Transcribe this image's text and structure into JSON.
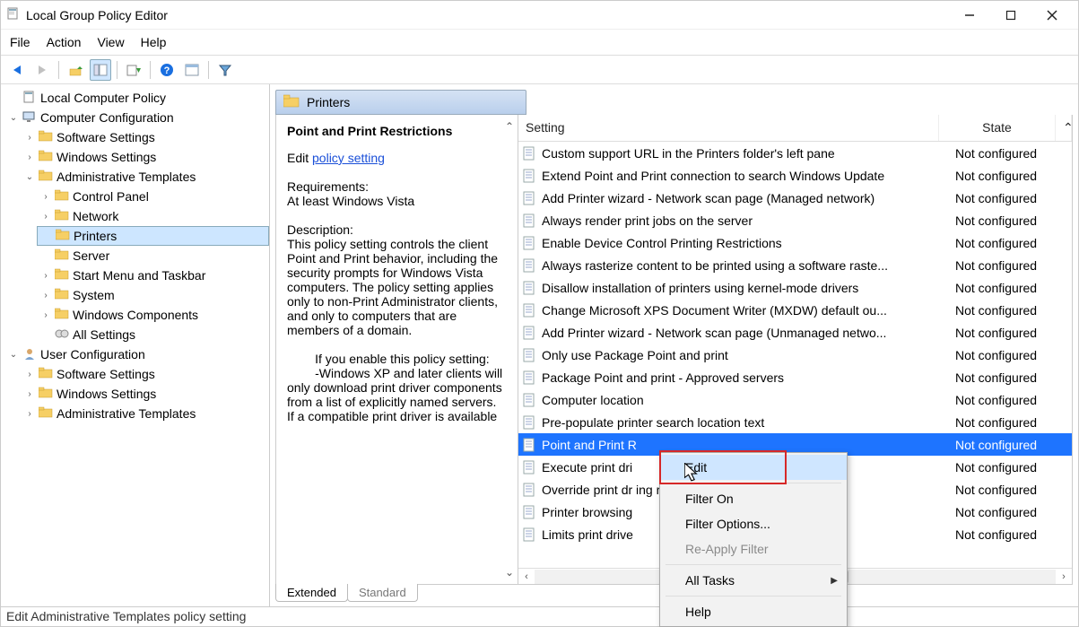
{
  "window": {
    "title": "Local Group Policy Editor",
    "controls": {
      "min": "—",
      "max": "▢",
      "close": "✕"
    }
  },
  "menubar": [
    "File",
    "Action",
    "View",
    "Help"
  ],
  "toolbar_icons": [
    "back-icon",
    "forward-icon",
    "up-icon",
    "show-hide-tree-icon",
    "export-icon",
    "help-icon",
    "properties-icon",
    "filter-icon"
  ],
  "tree": {
    "root": "Local Computer Policy",
    "computer_config": "Computer Configuration",
    "cc_children": {
      "software": "Software Settings",
      "windows": "Windows Settings",
      "admin_templates": "Administrative Templates",
      "at_children": {
        "control_panel": "Control Panel",
        "network": "Network",
        "printers": "Printers",
        "server": "Server",
        "start_menu": "Start Menu and Taskbar",
        "system": "System",
        "win_components": "Windows Components",
        "all_settings": "All Settings"
      }
    },
    "user_config": "User Configuration",
    "uc_children": {
      "software": "Software Settings",
      "windows": "Windows Settings",
      "admin_templates": "Administrative Templates"
    }
  },
  "right_header": "Printers",
  "detail": {
    "heading": "Point and Print Restrictions",
    "edit_label": "Edit",
    "edit_link": "policy setting",
    "requirements_label": "Requirements:",
    "requirements_text": "At least Windows Vista",
    "description_label": "Description:",
    "description_text": "This policy setting controls the client Point and Print behavior, including the security prompts for Windows Vista computers. The policy setting applies only to non-Print Administrator clients, and only to computers that are members of a domain.",
    "enable_intro": "        If you enable this policy setting:",
    "enable_bullet": "        -Windows XP and later clients will only download print driver components from a list of explicitly named servers. If a compatible print driver is available"
  },
  "columns": {
    "setting": "Setting",
    "state": "State"
  },
  "rows": [
    {
      "name": "Custom support URL in the Printers folder's left pane",
      "state": "Not configured"
    },
    {
      "name": "Extend Point and Print connection to search Windows Update",
      "state": "Not configured"
    },
    {
      "name": "Add Printer wizard - Network scan page (Managed network)",
      "state": "Not configured"
    },
    {
      "name": "Always render print jobs on the server",
      "state": "Not configured"
    },
    {
      "name": "Enable Device Control Printing Restrictions",
      "state": "Not configured"
    },
    {
      "name": "Always rasterize content to be printed using a software raste...",
      "state": "Not configured"
    },
    {
      "name": "Disallow installation of printers using kernel-mode drivers",
      "state": "Not configured"
    },
    {
      "name": "Change Microsoft XPS Document Writer (MXDW) default ou...",
      "state": "Not configured"
    },
    {
      "name": "Add Printer wizard - Network scan page (Unmanaged netwo...",
      "state": "Not configured"
    },
    {
      "name": "Only use Package Point and print",
      "state": "Not configured"
    },
    {
      "name": "Package Point and print - Approved servers",
      "state": "Not configured"
    },
    {
      "name": "Computer location",
      "state": "Not configured"
    },
    {
      "name": "Pre-populate printer search location text",
      "state": "Not configured"
    },
    {
      "name": "Point and Print R",
      "state": "Not configured",
      "selected": true
    },
    {
      "name": "Execute print dri",
      "state": "Not configured"
    },
    {
      "name": "Override print dr                                                       ing reporte...",
      "state": "Not configured"
    },
    {
      "name": "Printer browsing",
      "state": "Not configured"
    },
    {
      "name": "Limits print drive",
      "state": "Not configured"
    }
  ],
  "context_menu": {
    "edit": "Edit",
    "filter_on": "Filter On",
    "filter_options": "Filter Options...",
    "reapply": "Re-Apply Filter",
    "all_tasks": "All Tasks",
    "help": "Help"
  },
  "tabs": {
    "extended": "Extended",
    "standard": "Standard"
  },
  "status": "Edit Administrative Templates policy setting"
}
